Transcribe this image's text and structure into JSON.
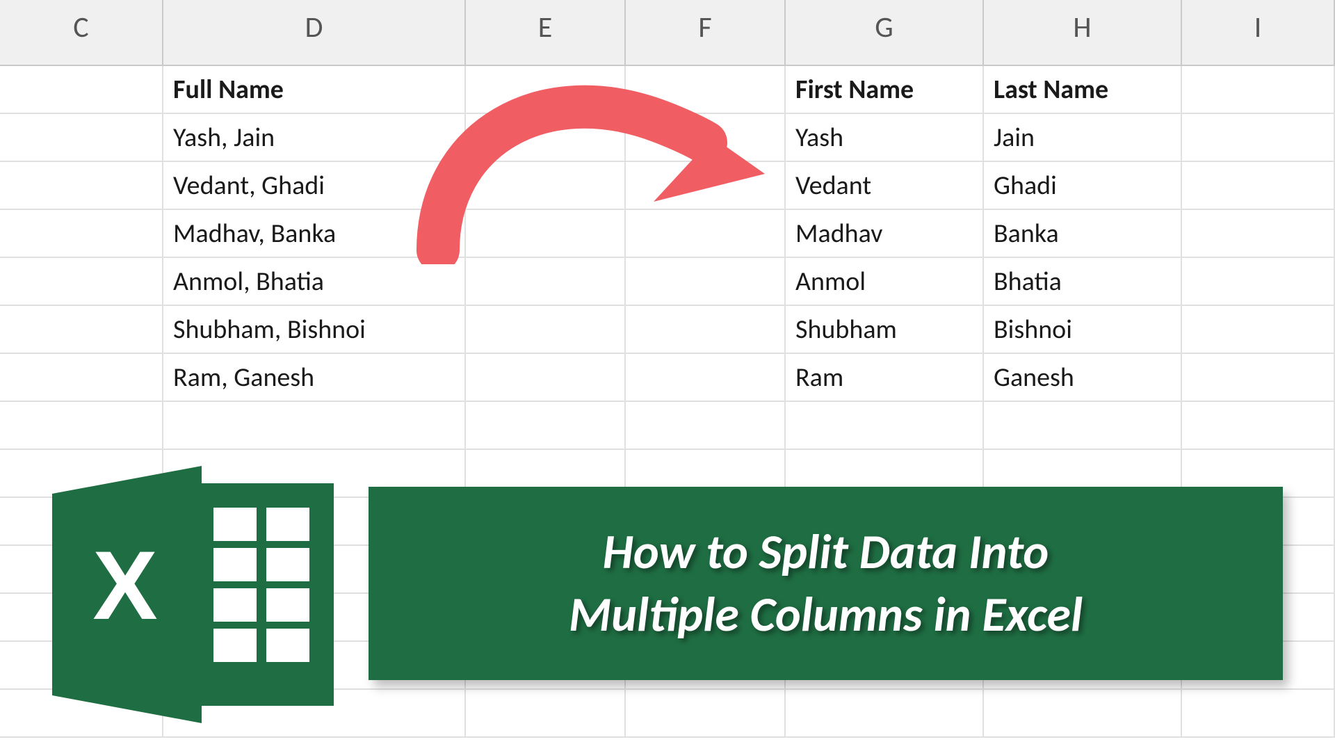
{
  "columns": {
    "C": "C",
    "D": "D",
    "E": "E",
    "F": "F",
    "G": "G",
    "H": "H",
    "I": "I"
  },
  "headers": {
    "fullName": "Full Name",
    "firstName": "First Name",
    "lastName": "Last Name"
  },
  "rows": [
    {
      "full": "Yash, Jain",
      "first": "Yash",
      "last": "Jain"
    },
    {
      "full": "Vedant, Ghadi",
      "first": "Vedant",
      "last": "Ghadi"
    },
    {
      "full": "Madhav, Banka",
      "first": "Madhav",
      "last": "Banka"
    },
    {
      "full": "Anmol, Bhatia",
      "first": "Anmol",
      "last": "Bhatia"
    },
    {
      "full": "Shubham, Bishnoi",
      "first": "Shubham",
      "last": "Bishnoi"
    },
    {
      "full": "Ram, Ganesh",
      "first": "Ram",
      "last": "Ganesh"
    }
  ],
  "banner": {
    "line1": "How to Split Data Into",
    "line2": "Multiple Columns in Excel"
  },
  "colors": {
    "accentGreen": "#1f6e43",
    "arrowRed": "#f05d62"
  }
}
